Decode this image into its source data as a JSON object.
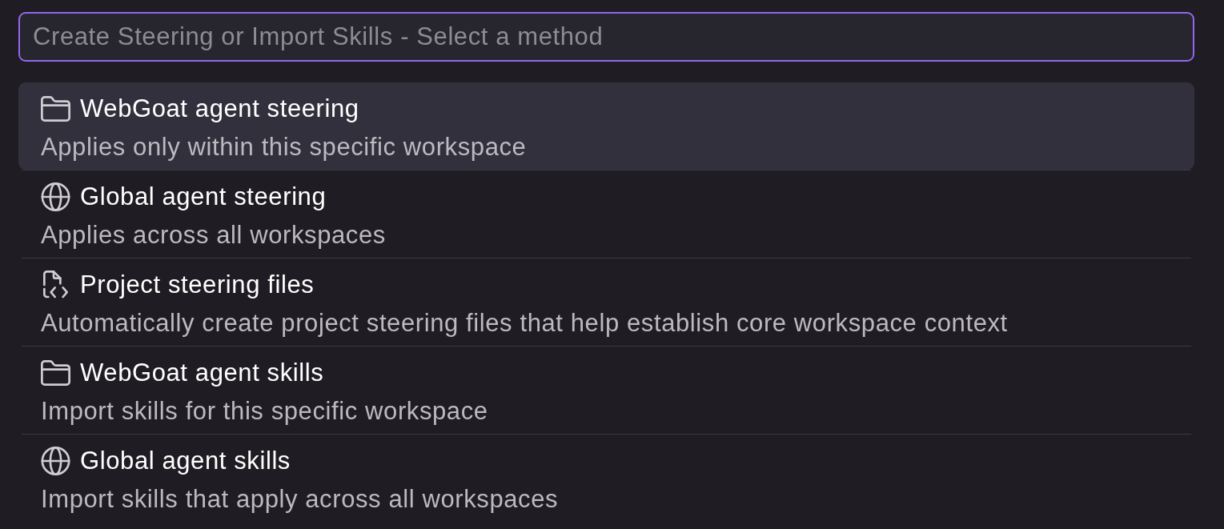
{
  "search": {
    "placeholder": "Create Steering or Import Skills - Select a method"
  },
  "items": [
    {
      "kind": "folder",
      "title": "WebGoat agent steering",
      "description": "Applies only within this specific workspace",
      "selected": true
    },
    {
      "kind": "globe",
      "title": "Global agent steering",
      "description": "Applies across all workspaces",
      "selected": false
    },
    {
      "kind": "file-code",
      "title": "Project steering files",
      "description": "Automatically create project steering files that help establish core workspace context",
      "selected": false
    },
    {
      "kind": "folder",
      "title": "WebGoat agent skills",
      "description": "Import skills for this specific workspace",
      "selected": false
    },
    {
      "kind": "globe",
      "title": "Global agent skills",
      "description": "Import skills that apply across all workspaces",
      "selected": false
    }
  ]
}
